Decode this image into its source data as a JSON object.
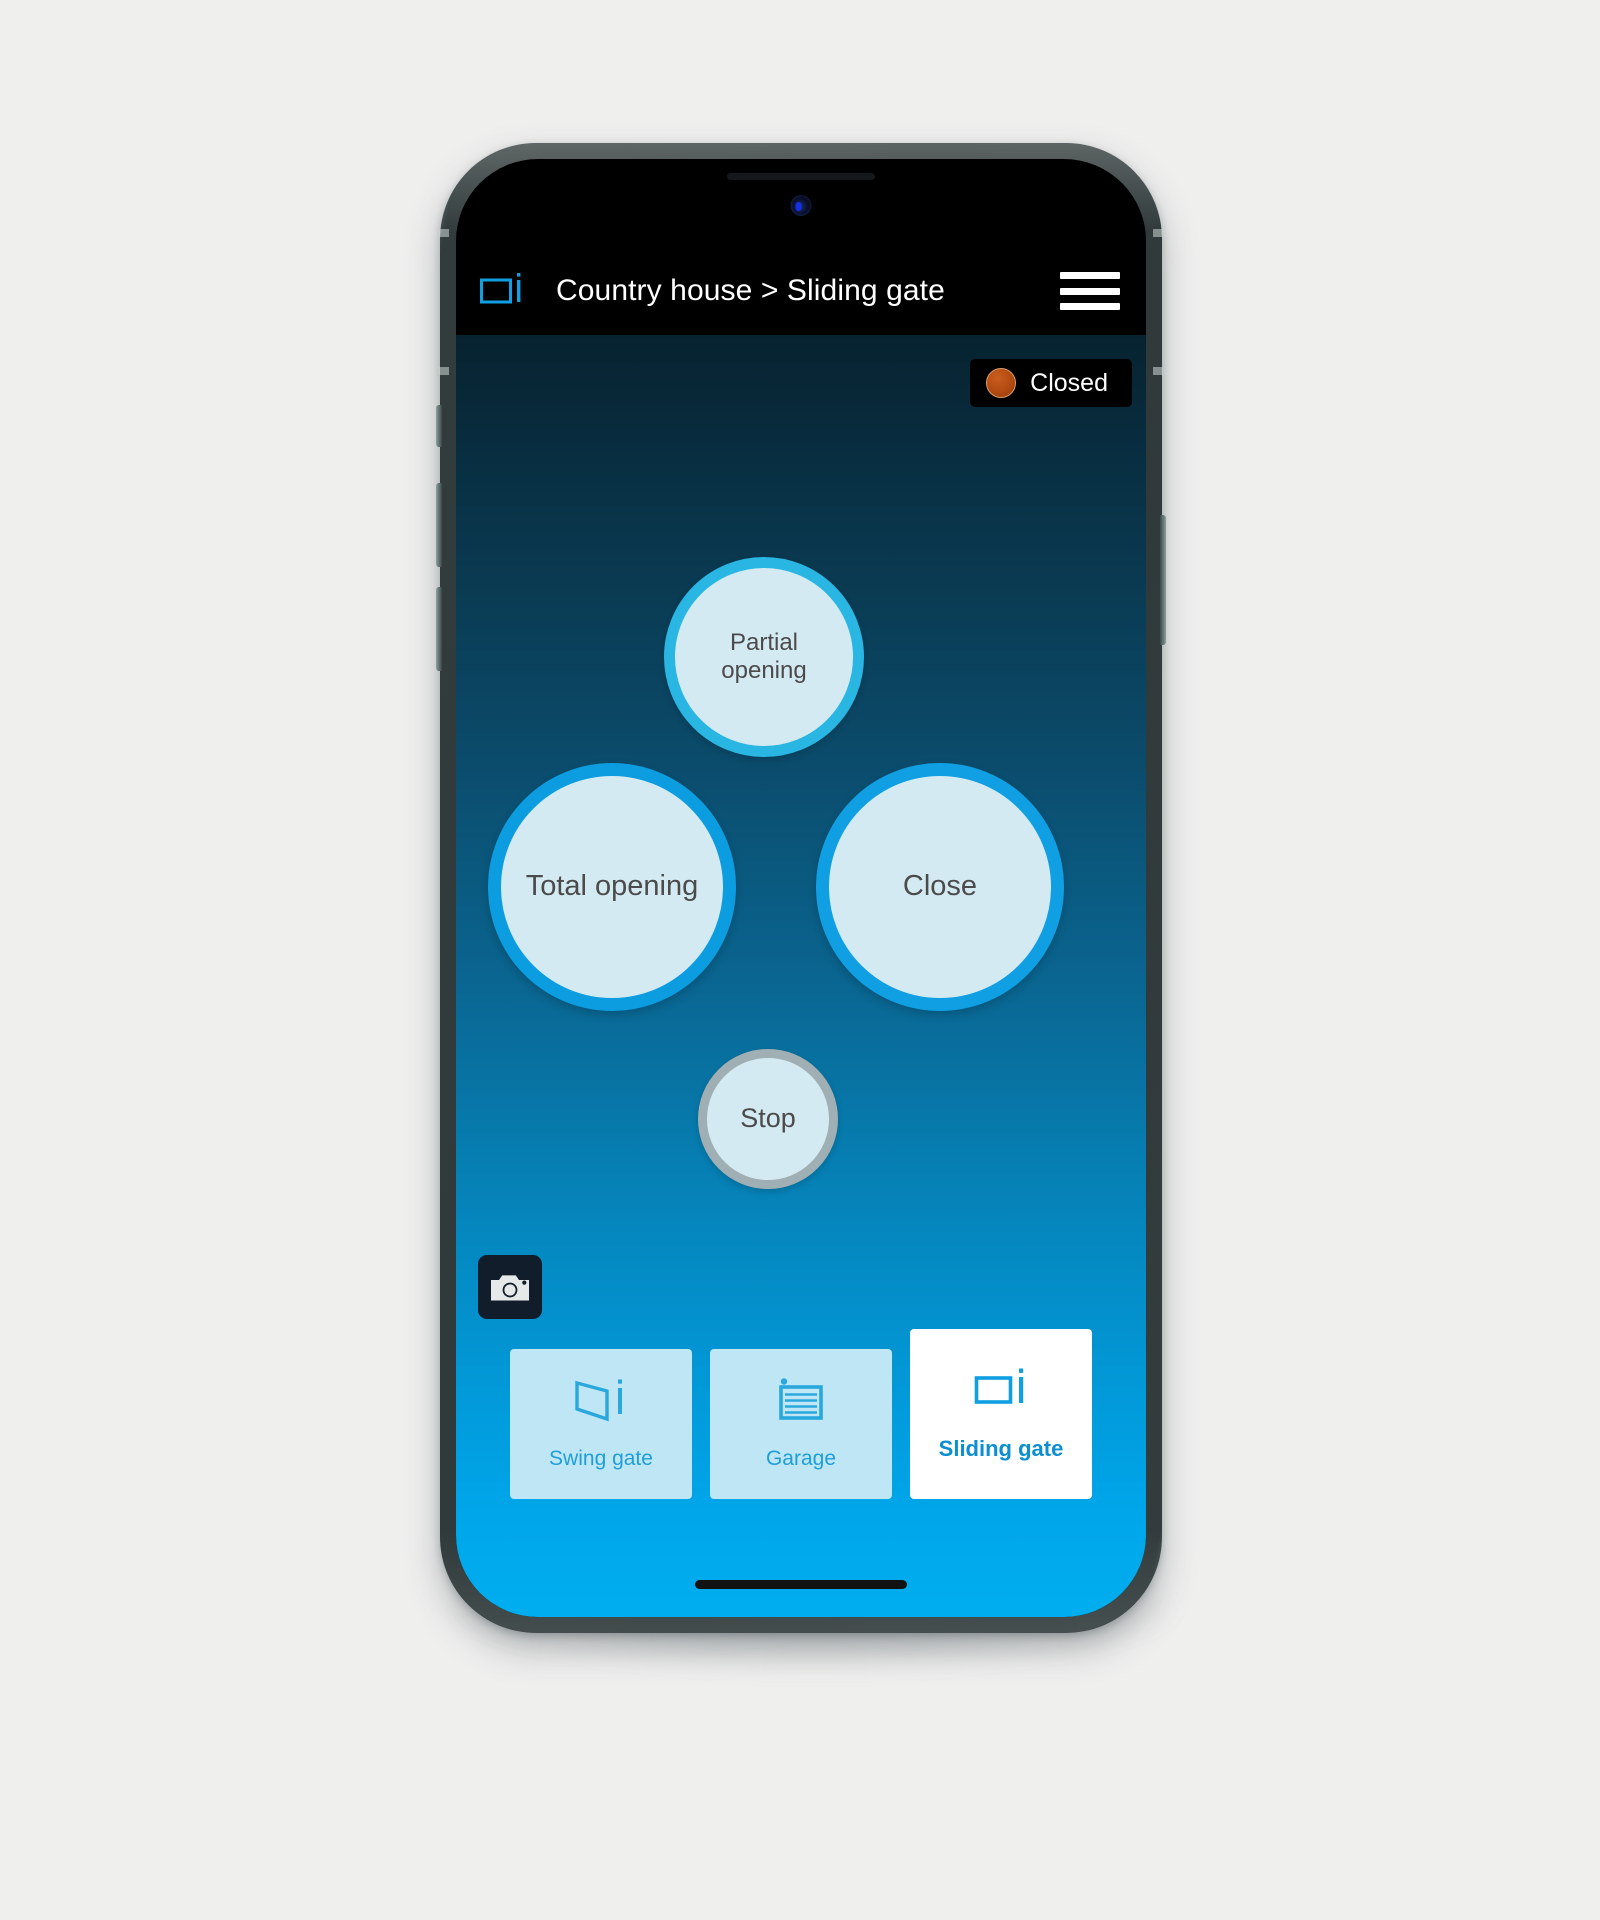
{
  "header": {
    "device_icon": "sliding-gate-icon",
    "title": "Country house > Sliding gate",
    "menu_icon": "hamburger-menu-icon"
  },
  "status": {
    "label": "Closed",
    "dot_color": "#b24a11",
    "badge_bg": "#000000"
  },
  "controls": [
    {
      "id": "partial-opening",
      "label": "Partial opening",
      "ring_color": "#29b6e3",
      "fill_color": "#d4eaf2"
    },
    {
      "id": "total-opening",
      "label": "Total opening",
      "ring_color": "#0c9ce0",
      "fill_color": "#d4eaf2"
    },
    {
      "id": "close",
      "label": "Close",
      "ring_color": "#0f9fe2",
      "fill_color": "#d4eaf2"
    },
    {
      "id": "stop",
      "label": "Stop",
      "ring_color": "#9fafb3",
      "fill_color": "#d4eaf2"
    }
  ],
  "camera": {
    "icon": "camera-icon"
  },
  "tabs": [
    {
      "id": "swing-gate",
      "label": "Swing gate",
      "icon": "swing-gate-icon",
      "active": false
    },
    {
      "id": "garage",
      "label": "Garage",
      "icon": "garage-door-icon",
      "active": false
    },
    {
      "id": "sliding-gate",
      "label": "Sliding gate",
      "icon": "sliding-gate-icon",
      "active": true
    }
  ],
  "theme": {
    "accent": "#00aeef",
    "accent_dark": "#07222f",
    "tab_inactive_bg": "#bfe6f5",
    "tab_active_bg": "#ffffff",
    "icon_blue": "#1f9fd8"
  }
}
